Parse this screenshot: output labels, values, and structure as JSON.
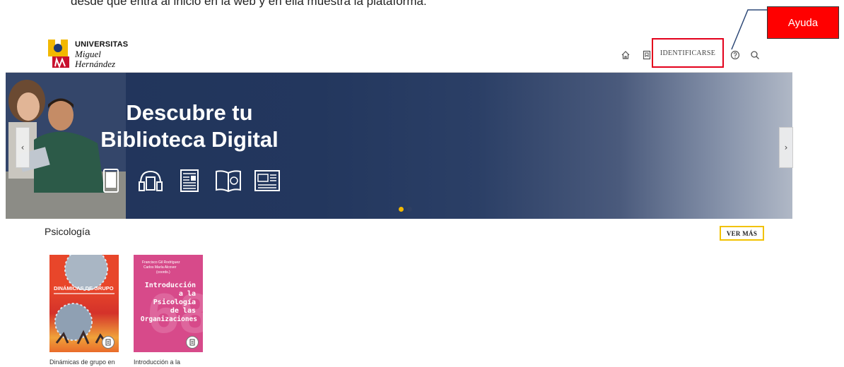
{
  "doc_text": "desde que entra al inicio en la web y en ella muestra la plataforma:",
  "logo": {
    "line1": "UNIVERSITAS",
    "line2": "Miguel",
    "line3": "Hernández"
  },
  "header": {
    "identify_label": "IDENTIFICARSE",
    "icons": [
      "home-icon",
      "bookmark-icon",
      "help-icon",
      "search-icon"
    ]
  },
  "callout": {
    "label": "Ayuda"
  },
  "banner": {
    "title_line1": "Descubre tu",
    "title_line2": "Biblioteca Digital",
    "prev_label": "‹",
    "next_label": "›",
    "slides": 2,
    "active_slide": 1
  },
  "section": {
    "title": "Psicología",
    "see_more": "VER MÁS",
    "books": [
      {
        "caption": "Dinámicas de grupo en",
        "cover_title": "DINÁMICAS DE GRUPO"
      },
      {
        "caption": "Introducción a la",
        "cover_title": "Introducción a la Psicología de las Organizaciones",
        "cover_authors": "Francisco Gil Rodríguez Carlos María Alcover (coords.)"
      }
    ]
  },
  "colors": {
    "accent": "#f2b800",
    "banner": "#22365c",
    "callout": "#ff0000",
    "highlight": "#e3001b"
  }
}
